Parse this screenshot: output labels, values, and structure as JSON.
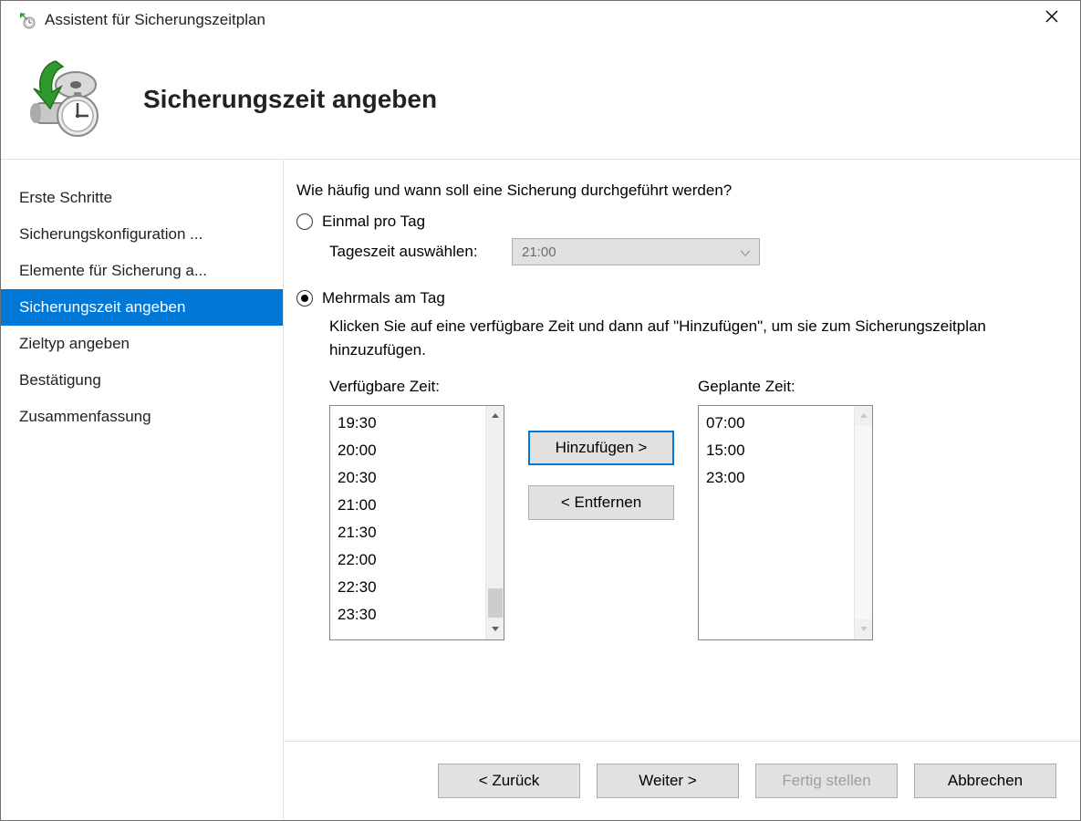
{
  "window": {
    "title": "Assistent für Sicherungszeitplan",
    "close_icon": "close-icon"
  },
  "header": {
    "page_title": "Sicherungszeit angeben"
  },
  "sidebar": {
    "items": [
      {
        "label": "Erste Schritte",
        "selected": false
      },
      {
        "label": "Sicherungskonfiguration ...",
        "selected": false
      },
      {
        "label": "Elemente für Sicherung a...",
        "selected": false
      },
      {
        "label": "Sicherungszeit angeben",
        "selected": true
      },
      {
        "label": "Zieltyp angeben",
        "selected": false
      },
      {
        "label": "Bestätigung",
        "selected": false
      },
      {
        "label": "Zusammenfassung",
        "selected": false
      }
    ]
  },
  "content": {
    "prompt": "Wie häufig und wann soll eine Sicherung durchgeführt werden?",
    "option_once": {
      "label": "Einmal pro Tag",
      "checked": false,
      "time_of_day_label": "Tageszeit auswählen:",
      "time_of_day_value": "21:00"
    },
    "option_multiple": {
      "label": "Mehrmals am Tag",
      "checked": true,
      "instruction": "Klicken Sie auf eine verfügbare Zeit und dann auf \"Hinzufügen\", um sie zum Sicherungszeitplan hinzuzufügen."
    },
    "available": {
      "label": "Verfügbare Zeit:",
      "items": [
        "19:30",
        "20:00",
        "20:30",
        "21:00",
        "21:30",
        "22:00",
        "22:30",
        "23:30"
      ]
    },
    "scheduled": {
      "label": "Geplante Zeit:",
      "items": [
        "07:00",
        "15:00",
        "23:00"
      ]
    },
    "buttons": {
      "add": "Hinzufügen >",
      "remove": "< Entfernen"
    }
  },
  "footer": {
    "back": "< Zurück",
    "next": "Weiter >",
    "finish": "Fertig stellen",
    "cancel": "Abbrechen"
  }
}
